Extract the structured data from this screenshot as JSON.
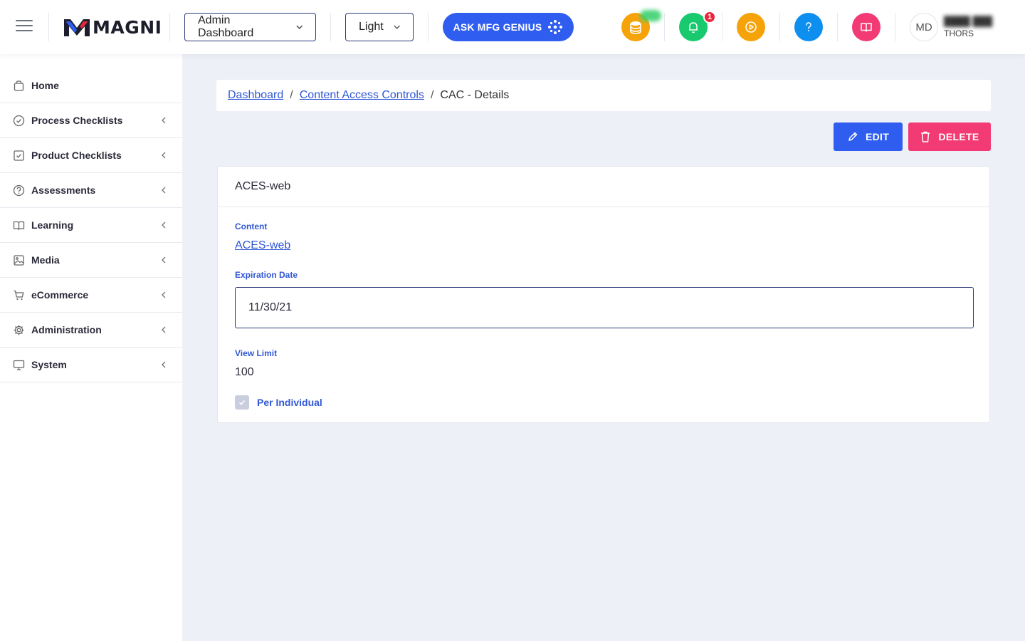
{
  "header": {
    "brand": "MAGNI",
    "dashboard_select": "Admin Dashboard",
    "theme_select": "Light",
    "ask_button": "ASK MFG GENIUS",
    "notification_count": "1",
    "avatar_initials": "MD",
    "user_org": "THORS",
    "colors": {
      "coins": "#f6a30a",
      "notifications": "#18c96e",
      "play": "#f6a30a",
      "help": "#0d8ff0",
      "book": "#f23a74"
    }
  },
  "sidebar": {
    "items": [
      {
        "label": "Home",
        "icon": "bag-icon"
      },
      {
        "label": "Process Checklists",
        "icon": "check-circle-icon"
      },
      {
        "label": "Product Checklists",
        "icon": "check-square-icon"
      },
      {
        "label": "Assessments",
        "icon": "question-circle-icon"
      },
      {
        "label": "Learning",
        "icon": "book-open-icon"
      },
      {
        "label": "Media",
        "icon": "image-icon"
      },
      {
        "label": "eCommerce",
        "icon": "cart-icon"
      },
      {
        "label": "Administration",
        "icon": "gear-icon"
      },
      {
        "label": "System",
        "icon": "monitor-icon"
      }
    ]
  },
  "breadcrumb": {
    "items": [
      "Dashboard",
      "Content Access Controls"
    ],
    "current": "CAC - Details",
    "separator": "/"
  },
  "actions": {
    "edit": "EDIT",
    "delete": "DELETE"
  },
  "card": {
    "title": "ACES-web",
    "content_label": "Content",
    "content_value": "ACES-web",
    "expiration_label": "Expiration Date",
    "expiration_value": "11/30/21",
    "view_limit_label": "View Limit",
    "view_limit_value": "100",
    "per_individual_label": "Per Individual",
    "per_individual_checked": true
  }
}
